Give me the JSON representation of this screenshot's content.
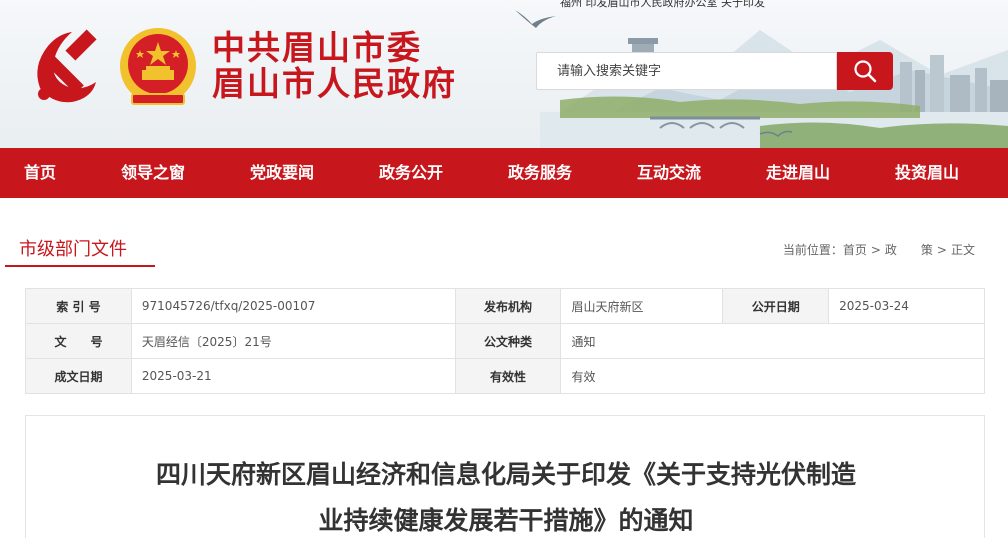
{
  "header": {
    "top_strip_text": "福州 印发眉山市人民政府办公室 关于印发 ",
    "title_line1": "中共眉山市委",
    "title_line2": "眉山市人民政府"
  },
  "search": {
    "placeholder": "请输入搜索关键字"
  },
  "nav": {
    "items": [
      "首页",
      "领导之窗",
      "党政要闻",
      "政务公开",
      "政务服务",
      "互动交流",
      "走进眉山",
      "投资眉山"
    ]
  },
  "section": {
    "title": "市级部门文件"
  },
  "breadcrumb": {
    "prefix": "当前位置：",
    "items": [
      "首页",
      "政　　策",
      "正文"
    ],
    "separator": ">"
  },
  "meta": {
    "rows": [
      [
        {
          "key": "索 引 号",
          "value": "971045726/tfxq/2025-00107"
        },
        {
          "key": "发布机构",
          "value": "眉山天府新区"
        },
        {
          "key": "公开日期",
          "value": "2025-03-24"
        }
      ],
      [
        {
          "key": "文　　号",
          "value": "天眉经信〔2025〕21号"
        },
        {
          "key": "公文种类",
          "value": "通知"
        }
      ],
      [
        {
          "key": "成文日期",
          "value": "2025-03-21"
        },
        {
          "key": "有效性",
          "value": "有效"
        }
      ]
    ]
  },
  "article": {
    "title_line1": "四川天府新区眉山经济和信息化局关于印发《关于支持光伏制造",
    "title_line2": "业持续健康发展若干措施》的通知"
  },
  "colors": {
    "brand_red": "#c8161d",
    "gold": "#f2c12e"
  },
  "icons": {
    "party": "hammer-sickle-icon",
    "emblem": "national-emblem-icon",
    "search": "search-icon"
  }
}
